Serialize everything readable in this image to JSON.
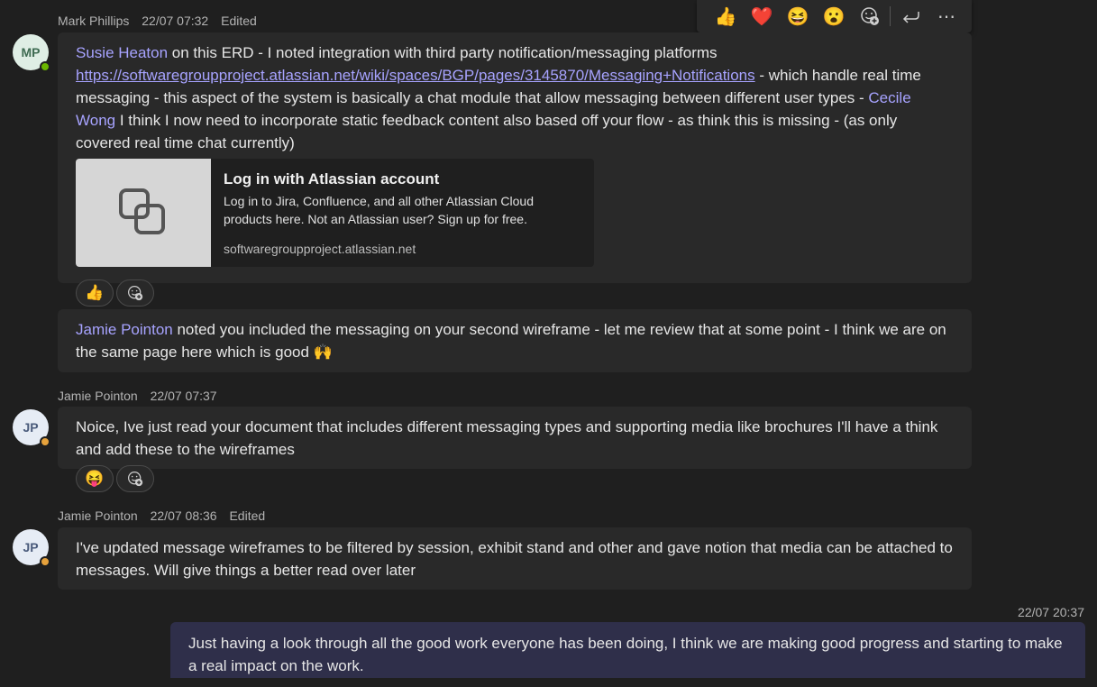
{
  "toolbar": {
    "reactions": [
      "👍",
      "❤️",
      "😆",
      "😮"
    ],
    "more_label": "⋯"
  },
  "messages": [
    {
      "author": "Mark Phillips",
      "time": "22/07 07:32",
      "edited": "Edited",
      "initials": "MP",
      "parts": [
        {
          "mention": "Susie Heaton"
        },
        {
          "text": " on this ERD - I noted integration with third party notification/messaging  platforms "
        },
        {
          "link": "https://softwaregroupproject.atlassian.net/wiki/spaces/BGP/pages/3145870/Messaging+Notifications"
        },
        {
          "text": " - which handle real time messaging - this aspect of the system is basically a chat module that allow messaging between different user types - "
        },
        {
          "mention": "Cecile Wong"
        },
        {
          "text": " I think I now need to incorporate static feedback content also based off your flow - as think this is missing - (as only covered real time chat currently)"
        }
      ],
      "card": {
        "title": "Log in with Atlassian account",
        "description": "Log in to Jira, Confluence, and all other Atlassian Cloud products here. Not an Atlassian user? Sign up for free.",
        "domain": "softwaregroupproject.atlassian.net"
      },
      "reaction": "👍"
    },
    {
      "mention": "Jamie Pointon",
      "text": " noted you included the messaging on your second wireframe - let me review that at some point - I think we are on the same page here which is good 🙌"
    },
    {
      "author": "Jamie Pointon",
      "time": "22/07 07:37",
      "initials": "JP",
      "text": "Noice, Ive just read your document that includes different messaging types and supporting media like brochures I'll have a think and add these to the wireframes",
      "reaction": "😝"
    },
    {
      "author": "Jamie Pointon",
      "time": "22/07 08:36",
      "edited": "Edited",
      "initials": "JP",
      "text": "I've updated message wireframes to be filtered by session, exhibit stand and other and gave notion that media can be attached to messages. Will give things a better read over later"
    },
    {
      "time": "22/07 20:37",
      "text": "Just having a look through all the good work everyone has been doing, I think we are making good progress and starting to make a real impact on the work."
    }
  ]
}
